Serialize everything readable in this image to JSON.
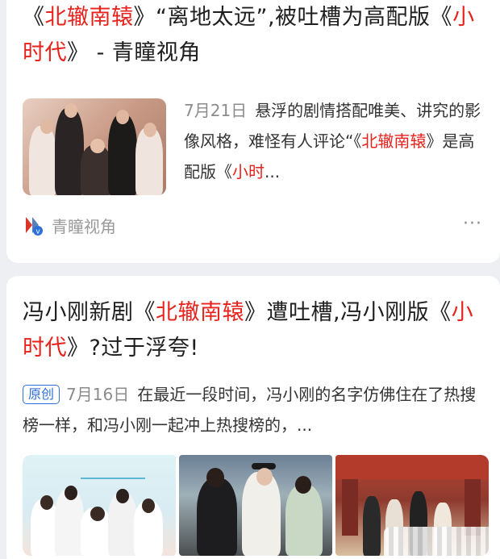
{
  "card1": {
    "title_parts": {
      "p1": "《",
      "h1": "北辙南辕",
      "p2": "》“离地太远”,被吐槽为高配版《",
      "h2": "小时代",
      "p3": "》 - 青瞳视角"
    },
    "snippet": {
      "date": "7月21日",
      "t1": "悬浮的剧情搭配唯美、讲究的影像风格，难怪有人评论“《",
      "hl1": "北辙南辕",
      "t2": "》是高配版《",
      "hl2": "小时",
      "t3": "..."
    },
    "source_name": "青瞳视角",
    "more_icon": "ellipsis-icon",
    "more_label": "···"
  },
  "card2": {
    "title_parts": {
      "p1": "冯小刚新剧《",
      "h1": "北辙南辕",
      "p2": "》遭吐槽,冯小刚版《",
      "h2": "小时代",
      "p3": "》?过于浮夸!"
    },
    "badge": "原创",
    "date": "7月16日",
    "snippet": "在最近一段时间，冯小刚的名字仿佛住在了热搜榜一样，和冯小刚一起冲上热搜榜的，..."
  },
  "colors": {
    "highlight": "#e8221d",
    "badge": "#2e6fd9",
    "meta": "#8b8b8b"
  }
}
